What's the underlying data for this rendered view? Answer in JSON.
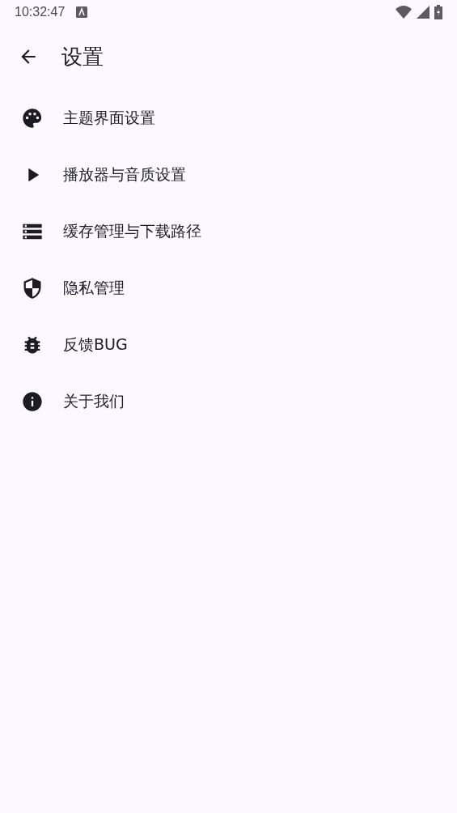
{
  "status_bar": {
    "time": "10:32:47"
  },
  "toolbar": {
    "title": "设置"
  },
  "items": [
    {
      "kind": "palette",
      "label": "主题界面设置"
    },
    {
      "kind": "play",
      "label": "播放器与音质设置"
    },
    {
      "kind": "storage",
      "label": "缓存管理与下载路径"
    },
    {
      "kind": "shield",
      "label": "隐私管理"
    },
    {
      "kind": "bug",
      "label": "反馈BUG"
    },
    {
      "kind": "info",
      "label": "关于我们"
    }
  ]
}
